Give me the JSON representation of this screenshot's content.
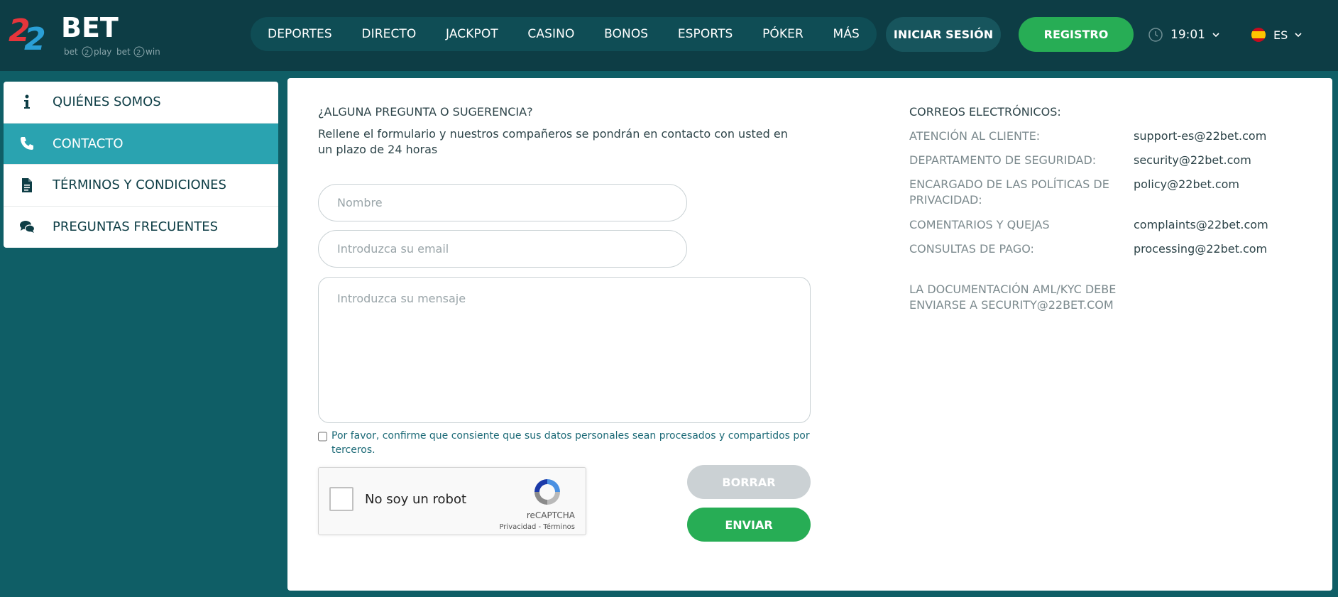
{
  "logo": {
    "brand_number": "22",
    "brand_name": "BET",
    "tagline_left": "bet",
    "tagline_left_num": "2",
    "tagline_left_word": "play",
    "tagline_right": "bet",
    "tagline_right_num": "2",
    "tagline_right_word": "win"
  },
  "nav": {
    "items": [
      {
        "label": "DEPORTES"
      },
      {
        "label": "DIRECTO"
      },
      {
        "label": "JACKPOT"
      },
      {
        "label": "CASINO"
      },
      {
        "label": "BONOS"
      },
      {
        "label": "ESPORTS"
      },
      {
        "label": "PÓKER"
      },
      {
        "label": "MÁS"
      }
    ]
  },
  "header": {
    "login_label": "INICIAR SESIÓN",
    "register_label": "REGISTRO",
    "time": "19:01",
    "language": "ES"
  },
  "sidebar": {
    "items": [
      {
        "label": "QUIÉNES SOMOS",
        "icon": "info-icon"
      },
      {
        "label": "CONTACTO",
        "icon": "phone-icon",
        "active": true
      },
      {
        "label": "TÉRMINOS Y CONDICIONES",
        "icon": "document-icon"
      },
      {
        "label": "PREGUNTAS FRECUENTES",
        "icon": "chat-icon"
      }
    ]
  },
  "form": {
    "title": "¿ALGUNA PREGUNTA O SUGERENCIA?",
    "subtitle": "Rellene el formulario y nuestros compañeros se pondrán en contacto con usted en un plazo de 24 horas",
    "name_placeholder": "Nombre",
    "email_placeholder": "Introduzca su email",
    "message_placeholder": "Introduzca su mensaje",
    "consent_text": "Por favor, confirme que consiente que sus datos personales sean procesados y compartidos por terceros.",
    "captcha_label": "No soy un robot",
    "captcha_brand": "reCAPTCHA",
    "captcha_links": "Privacidad - Términos",
    "clear_label": "BORRAR",
    "send_label": "ENVIAR"
  },
  "contacts": {
    "title": "CORREOS ELECTRÓNICOS:",
    "rows": [
      {
        "label": "ATENCIÓN AL CLIENTE:",
        "email": "support-es@22bet.com"
      },
      {
        "label": "DEPARTAMENTO DE SEGURIDAD:",
        "email": "security@22bet.com"
      },
      {
        "label": "ENCARGADO DE LAS POLÍTICAS DE PRIVACIDAD:",
        "email": "policy@22bet.com"
      },
      {
        "label": "COMENTARIOS Y QUEJAS",
        "email": "complaints@22bet.com"
      },
      {
        "label": "CONSULTAS DE PAGO:",
        "email": "processing@22bet.com"
      }
    ],
    "aml_note": "LA DOCUMENTACIÓN AML/KYC DEBE ENVIARSE A SECURITY@22BET.COM"
  },
  "colors": {
    "header_bg": "#0d3d45",
    "page_bg": "#0f5e66",
    "accent_teal": "#2aa3b0",
    "accent_green": "#27ad55",
    "logo_red": "#e5353b",
    "logo_blue": "#2a9fd6"
  }
}
